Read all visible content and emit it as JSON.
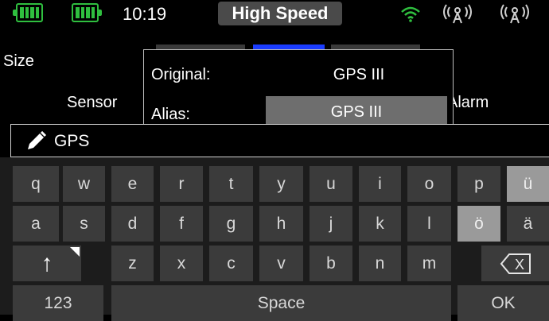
{
  "status_bar": {
    "time": "10:19",
    "mode": "High Speed",
    "icons": [
      "battery-icon",
      "battery-icon",
      "wifi-icon",
      "antenna-icon",
      "antenna-icon"
    ],
    "accent_green": "#2fbf3f"
  },
  "background": {
    "size_label": "Size",
    "sensor_label": "Sensor",
    "alarm_label": "Alarm"
  },
  "popup": {
    "original_label": "Original:",
    "original_value": "GPS III",
    "alias_label": "Alias:",
    "alias_value": "GPS III"
  },
  "edit_field": {
    "value": "GPS",
    "icon": "pencil-icon"
  },
  "keyboard": {
    "row1": [
      "q",
      "w",
      "e",
      "r",
      "t",
      "y",
      "u",
      "i",
      "o",
      "p",
      "ü"
    ],
    "row2": [
      "a",
      "s",
      "d",
      "f",
      "g",
      "h",
      "j",
      "k",
      "l",
      "ö",
      "ä"
    ],
    "row3": [
      "z",
      "x",
      "c",
      "v",
      "b",
      "n",
      "m"
    ],
    "shift_glyph": "↑",
    "backspace_glyph": "X",
    "numbers_label": "123",
    "space_label": "Space",
    "ok_label": "OK"
  }
}
